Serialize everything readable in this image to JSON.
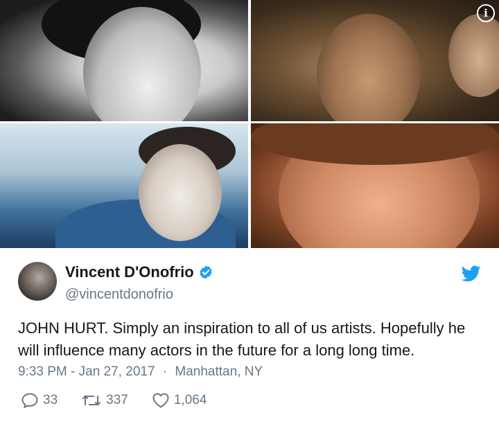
{
  "media": {
    "photos": [
      "photo-1",
      "photo-2",
      "photo-3",
      "photo-4"
    ],
    "info_icon": "i"
  },
  "tweet": {
    "author_name": "Vincent D'Onofrio",
    "handle": "@vincentdonofrio",
    "text": "JOHN HURT. Simply an inspiration to all of us artists. Hopefully he will influence many actors in the future for a long long time.",
    "timestamp": "9:33 PM - Jan 27, 2017",
    "separator": "·",
    "location": "Manhattan, NY",
    "replies": "33",
    "retweets": "337",
    "likes": "1,064"
  },
  "icons": {
    "verified": "verified-badge-icon",
    "brand": "twitter-bird-icon",
    "reply": "reply-icon",
    "retweet": "retweet-icon",
    "like": "heart-icon"
  },
  "colors": {
    "twitter_blue": "#1da1f2",
    "secondary_text": "#657786",
    "primary_text": "#14171a"
  }
}
